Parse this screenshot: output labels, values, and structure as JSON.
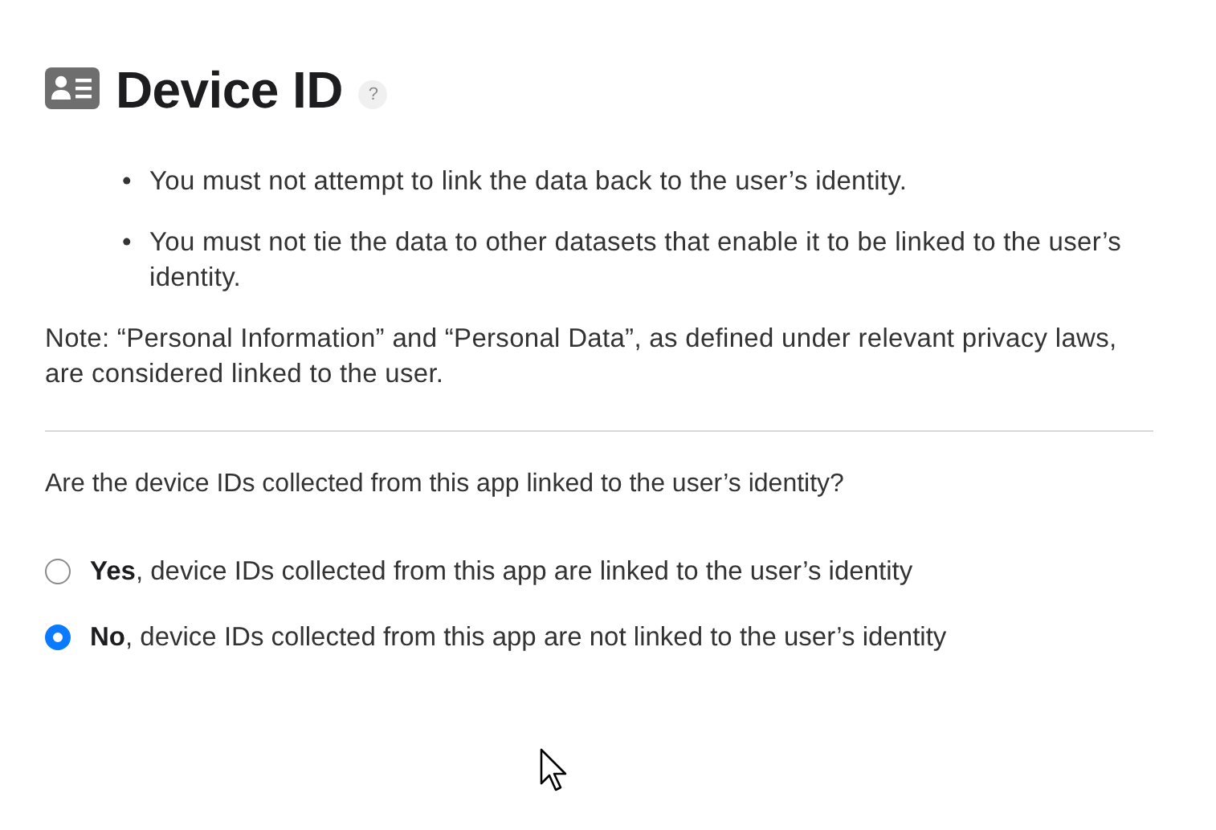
{
  "heading": {
    "title": "Device ID",
    "help": "?"
  },
  "bullets": [
    {
      "marker": "•",
      "text": "You must not attempt to link the data back to the user’s identity."
    },
    {
      "marker": "•",
      "text": "You must not tie the data to other datasets that enable it to be linked to the user’s identity."
    }
  ],
  "note": "Note: “Personal Information” and “Personal Data”, as defined under relevant privacy laws, are considered linked to the user.",
  "question": "Are the device IDs collected from this app linked to the user’s identity?",
  "options": [
    {
      "label": "**Yes**, device IDs collected from this app are linked to the user’s identity",
      "selected": false
    },
    {
      "label": "**No**, device IDs collected from this app are not linked to the user’s identity",
      "selected": true
    }
  ]
}
